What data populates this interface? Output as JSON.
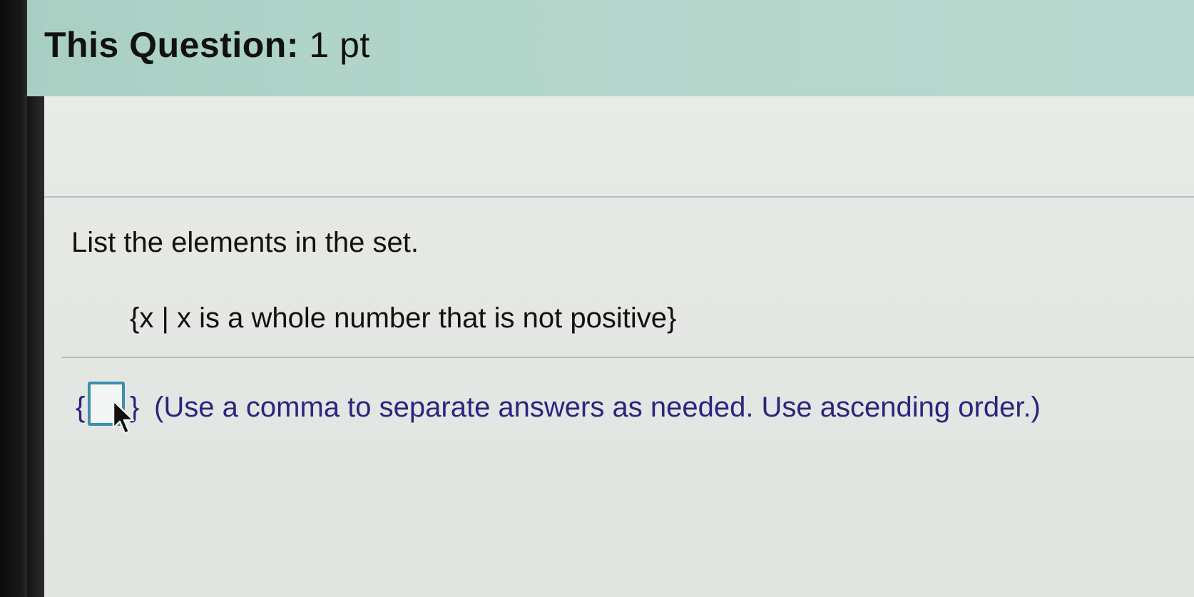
{
  "header": {
    "title_bold": "This Question:",
    "title_points": "1 pt"
  },
  "question": {
    "prompt": "List the elements in the set.",
    "set_definition": "{x | x is a whole number that is not positive}"
  },
  "answer": {
    "open_brace": "{",
    "close_brace": "}",
    "value": "",
    "instruction": "(Use a comma to separate answers as needed. Use ascending order.)"
  },
  "icons": {
    "cursor": "mouse-pointer-icon"
  },
  "colors": {
    "header_bg": "#b3d6cb",
    "answer_text": "#2a2580",
    "input_border": "#3c8fae"
  }
}
